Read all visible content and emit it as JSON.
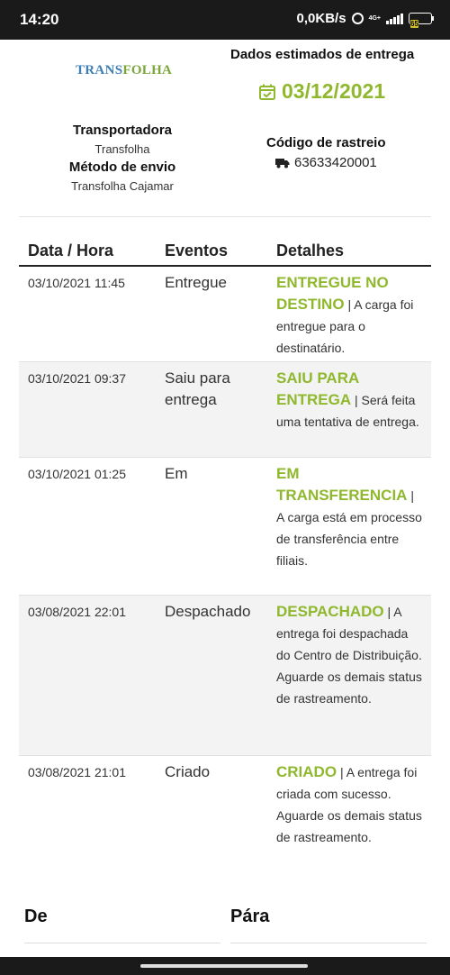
{
  "statusbar": {
    "time": "14:20",
    "speed": "0,0KB/s",
    "network": "4G+",
    "battery": "65"
  },
  "header": {
    "logo_prefix": "Trans",
    "logo_suffix": "Folha",
    "carrier_title": "Transportadora",
    "carrier_value": "Transfolha",
    "method_title": "Método de envio",
    "method_value": "Transfolha Cajamar",
    "estimate_title": "Dados estimados de entrega",
    "estimate_date": "03/12/2021",
    "tracking_title": "Código de rastreio",
    "tracking_number": "63633420001"
  },
  "table": {
    "headers": [
      "Data / Hora",
      "Eventos",
      "Detalhes"
    ],
    "rows": [
      {
        "datetime": "03/10/2021 11:45",
        "event": "Entregue",
        "status": "ENTREGUE NO DESTINO",
        "detail": "A carga foi entregue para o destinatário."
      },
      {
        "datetime": "03/10/2021 09:37",
        "event": "Saiu para entrega",
        "status": "SAIU PARA ENTREGA",
        "detail": "Será feita uma tentativa de entrega."
      },
      {
        "datetime": "03/10/2021 01:25",
        "event": "Em",
        "status": "EM TRANSFERENCIA",
        "detail": "A carga está em processo de transferência entre filiais."
      },
      {
        "datetime": "03/08/2021 22:01",
        "event": "Despachado",
        "status": "DESPACHADO",
        "detail": "A entrega foi despachada do Centro de Distribuição. Aguarde os demais status de rastreamento."
      },
      {
        "datetime": "03/08/2021 21:01",
        "event": "Criado",
        "status": "CRIADO",
        "detail": "A entrega foi criada com sucesso. Aguarde os demais status de rastreamento."
      }
    ]
  },
  "footer": {
    "from_label": "De",
    "to_label": "Pára"
  },
  "colors": {
    "accent": "#8fb82e",
    "statusbar": "#1a1a1a"
  }
}
